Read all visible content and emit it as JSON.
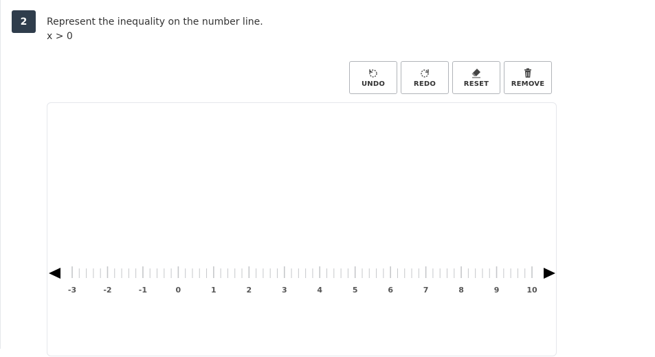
{
  "question": {
    "number": "2",
    "prompt": "Represent the inequality on the number line.",
    "expression": "x > 0"
  },
  "toolbar": {
    "undo_label": "UNDO",
    "redo_label": "REDO",
    "reset_label": "RESET",
    "remove_label": "REMOVE",
    "icons": [
      "undo-icon",
      "redo-icon",
      "eraser-icon",
      "trash-icon"
    ]
  },
  "number_line": {
    "min": -3,
    "max": 10,
    "major_step": 1,
    "minor_per_major": 4,
    "labels": [
      "-3",
      "-2",
      "-1",
      "0",
      "1",
      "2",
      "3",
      "4",
      "5",
      "6",
      "7",
      "8",
      "9",
      "10"
    ],
    "arrows": [
      "left-arrow",
      "right-arrow"
    ],
    "color": "#000000",
    "tick_color": "#c5c7ca",
    "label_color": "#555555"
  }
}
